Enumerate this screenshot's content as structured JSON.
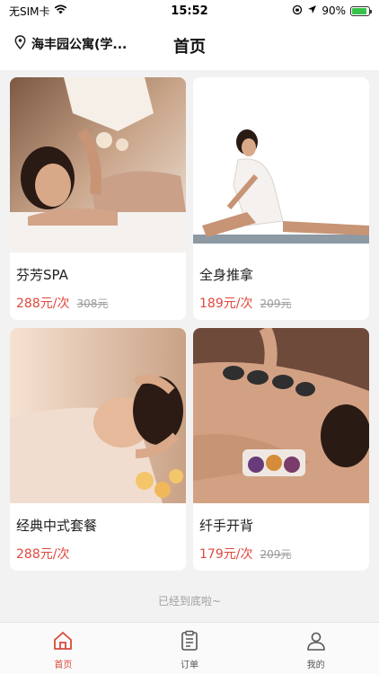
{
  "status_bar": {
    "carrier": "无SIM卡",
    "time": "15:52",
    "battery": "90%",
    "battery_level": 0.9
  },
  "header": {
    "location": "海丰园公寓(学...",
    "title": "首页"
  },
  "products": [
    {
      "name": "芬芳SPA",
      "price": "288元/次",
      "old_price": "308元"
    },
    {
      "name": "全身推拿",
      "price": "189元/次",
      "old_price": "209元"
    },
    {
      "name": "经典中式套餐",
      "price": "288元/次",
      "old_price": ""
    },
    {
      "name": "纤手开背",
      "price": "179元/次",
      "old_price": "209元"
    }
  ],
  "list_end_text": "已经到底啦~",
  "tabs": [
    {
      "label": "首页",
      "icon": "home-icon",
      "active": true
    },
    {
      "label": "订单",
      "icon": "order-icon",
      "active": false
    },
    {
      "label": "我的",
      "icon": "profile-icon",
      "active": false
    }
  ],
  "colors": {
    "accent": "#d74a3b",
    "price": "#e0483e",
    "background": "#f2f2f2"
  }
}
